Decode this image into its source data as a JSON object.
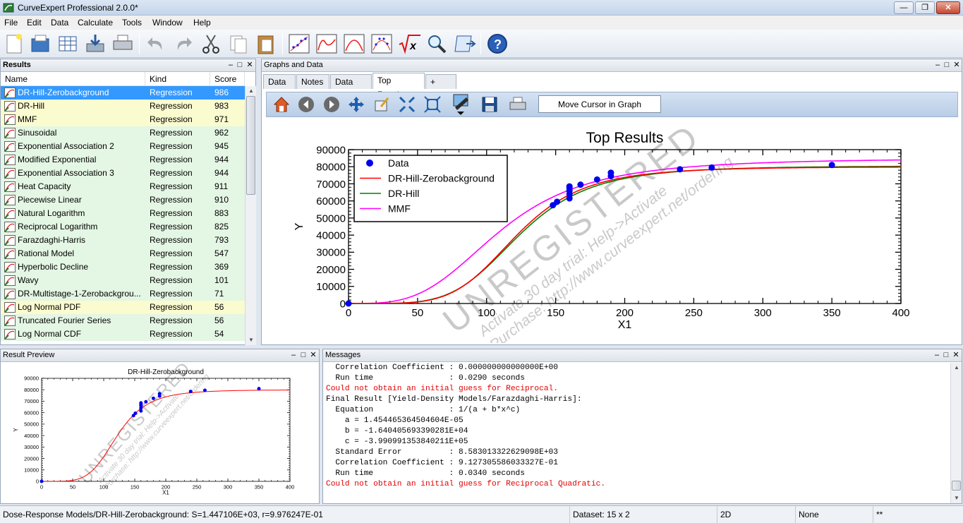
{
  "window": {
    "title": "CurveExpert Professional 2.0.0*",
    "minimize": "—",
    "maximize": "❐",
    "close": "✕"
  },
  "menu": [
    "File",
    "Edit",
    "Data",
    "Calculate",
    "Tools",
    "Window",
    "Help"
  ],
  "toolbar": {
    "buttons": [
      "new-icon",
      "open-icon",
      "data-grid-icon",
      "import-icon",
      "print-icon",
      "undo-icon",
      "redo-icon",
      "cut-icon",
      "copy-icon",
      "paste-icon",
      "scatter-plot-icon",
      "line-plot-icon",
      "curve-plot-icon",
      "residual-plot-icon",
      "function-icon",
      "zoom-icon",
      "script-icon",
      "help-icon"
    ]
  },
  "results_panel": {
    "title": "Results",
    "columns": [
      "Name",
      "Kind",
      "Score"
    ],
    "rows": [
      {
        "name": "DR-Hill-Zerobackground",
        "kind": "Regression",
        "score": "986",
        "color": "#3399ff",
        "selected": true
      },
      {
        "name": "DR-Hill",
        "kind": "Regression",
        "score": "983",
        "color": "#fbfbd0"
      },
      {
        "name": "MMF",
        "kind": "Regression",
        "score": "971",
        "color": "#fbfbd0"
      },
      {
        "name": "Sinusoidal",
        "kind": "Regression",
        "score": "962",
        "color": "#e4f6e4"
      },
      {
        "name": "Exponential Association 2",
        "kind": "Regression",
        "score": "945",
        "color": "#e4f6e4"
      },
      {
        "name": "Modified Exponential",
        "kind": "Regression",
        "score": "944",
        "color": "#e4f6e4"
      },
      {
        "name": "Exponential Association 3",
        "kind": "Regression",
        "score": "944",
        "color": "#e4f6e4"
      },
      {
        "name": "Heat Capacity",
        "kind": "Regression",
        "score": "911",
        "color": "#e4f6e4"
      },
      {
        "name": "Piecewise Linear",
        "kind": "Regression",
        "score": "910",
        "color": "#e4f6e4"
      },
      {
        "name": "Natural Logarithm",
        "kind": "Regression",
        "score": "883",
        "color": "#e4f6e4"
      },
      {
        "name": "Reciprocal Logarithm",
        "kind": "Regression",
        "score": "825",
        "color": "#e4f6e4"
      },
      {
        "name": "Farazdaghi-Harris",
        "kind": "Regression",
        "score": "793",
        "color": "#e4f6e4"
      },
      {
        "name": "Rational Model",
        "kind": "Regression",
        "score": "547",
        "color": "#e4f6e4"
      },
      {
        "name": "Hyperbolic Decline",
        "kind": "Regression",
        "score": "369",
        "color": "#e4f6e4"
      },
      {
        "name": "Wavy",
        "kind": "Regression",
        "score": "101",
        "color": "#e4f6e4"
      },
      {
        "name": "DR-Multistage-1-Zerobackgrou...",
        "kind": "Regression",
        "score": "71",
        "color": "#e4f6e4"
      },
      {
        "name": "Log Normal PDF",
        "kind": "Regression",
        "score": "56",
        "color": "#fbfbd0"
      },
      {
        "name": "Truncated Fourier Series",
        "kind": "Regression",
        "score": "56",
        "color": "#e4f6e4"
      },
      {
        "name": "Log Normal CDF",
        "kind": "Regression",
        "score": "54",
        "color": "#e4f6e4"
      }
    ]
  },
  "graphs_panel": {
    "title": "Graphs and Data",
    "tabs": [
      "Data",
      "Notes",
      "Data Plot",
      "Top Results",
      "+"
    ],
    "active_tab": "Top Results",
    "graph_toolbar": [
      "home-icon",
      "back-icon",
      "forward-icon",
      "pan-icon",
      "edit-icon",
      "zoom-fit-icon",
      "zoom-select-icon",
      "color-icon",
      "save-icon",
      "print-icon"
    ],
    "cursor_label": "Move Cursor in Graph"
  },
  "chart_data": [
    {
      "type": "scatter",
      "title": "Top Results",
      "xlabel": "X1",
      "ylabel": "Y",
      "xlim": [
        0,
        400
      ],
      "ylim": [
        0,
        90000
      ],
      "xticks": [
        "0",
        "50",
        "100",
        "150",
        "200",
        "250",
        "300",
        "350",
        "400"
      ],
      "yticks": [
        "0",
        "10000",
        "20000",
        "30000",
        "40000",
        "50000",
        "60000",
        "70000",
        "80000",
        "90000"
      ],
      "legend_position": "top-left",
      "grid": false,
      "points": [
        [
          0,
          0
        ],
        [
          148,
          57500
        ],
        [
          151,
          59500
        ],
        [
          160,
          61500
        ],
        [
          160,
          64000
        ],
        [
          160,
          66000
        ],
        [
          160,
          67500
        ],
        [
          160,
          68500
        ],
        [
          168,
          69500
        ],
        [
          180,
          72500
        ],
        [
          190,
          74500
        ],
        [
          190,
          76500
        ],
        [
          240,
          78500
        ],
        [
          263,
          79500
        ],
        [
          350,
          81000
        ]
      ],
      "series": [
        {
          "name": "Data",
          "color": "#0000ee",
          "style": "points"
        },
        {
          "name": "DR-Hill-Zerobackground",
          "color": "#ff0000",
          "style": "line",
          "params": {
            "top": 80000,
            "ec50": 122,
            "slope": 5.0
          }
        },
        {
          "name": "DR-Hill",
          "color": "#008000",
          "style": "line",
          "params": {
            "top": 80500,
            "ec50": 124,
            "slope": 4.8
          }
        },
        {
          "name": "MMF",
          "color": "#ff00ff",
          "style": "line",
          "params": {
            "top": 85000,
            "ec50": 110,
            "slope": 3.4
          }
        }
      ],
      "watermark": [
        "UNREGISTERED",
        "Activate 30 day trial: Help->Activate",
        "Purchase: http://www.curveexpert.net/ordering"
      ]
    },
    {
      "type": "scatter",
      "title": "DR-Hill-Zerobackground",
      "xlabel": "X1",
      "ylabel": "Y",
      "xlim": [
        0,
        400
      ],
      "ylim": [
        0,
        90000
      ],
      "xticks": [
        "0",
        "50",
        "100",
        "150",
        "200",
        "250",
        "300",
        "350",
        "400"
      ],
      "yticks": [
        "0",
        "10000",
        "20000",
        "30000",
        "40000",
        "50000",
        "60000",
        "70000",
        "80000",
        "90000"
      ],
      "grid": false,
      "points": [
        [
          0,
          0
        ],
        [
          148,
          57500
        ],
        [
          151,
          59500
        ],
        [
          160,
          61500
        ],
        [
          160,
          64000
        ],
        [
          160,
          66000
        ],
        [
          160,
          67500
        ],
        [
          160,
          68500
        ],
        [
          168,
          69500
        ],
        [
          180,
          72500
        ],
        [
          190,
          74500
        ],
        [
          190,
          76500
        ],
        [
          240,
          78500
        ],
        [
          263,
          79500
        ],
        [
          350,
          81000
        ]
      ],
      "series": [
        {
          "name": "DR-Hill-Zerobackground",
          "color": "#ff0000",
          "style": "line",
          "params": {
            "top": 80000,
            "ec50": 122,
            "slope": 5.0
          }
        }
      ],
      "watermark": [
        "UNREGISTERED",
        "Activate 30 day trial: Help->Activate",
        "Purchase: http://www.curveexpert.net/ordering"
      ]
    }
  ],
  "preview_panel": {
    "title": "Result Preview"
  },
  "messages_panel": {
    "title": "Messages",
    "lines": [
      {
        "text": "  Correlation Coefficient : 0.000000000000000E+00",
        "error": false
      },
      {
        "text": "  Run time                : 0.0290 seconds",
        "error": false
      },
      {
        "text": "Could not obtain an initial guess for Reciprocal.",
        "error": true
      },
      {
        "text": "Final Result [Yield-Density Models/Farazdaghi-Harris]:",
        "error": false
      },
      {
        "text": "  Equation                : 1/(a + b*x^c)",
        "error": false
      },
      {
        "text": "    a = 1.454465364504604E-05",
        "error": false
      },
      {
        "text": "    b = -1.640405693390281E+04",
        "error": false
      },
      {
        "text": "    c = -3.990991353840211E+05",
        "error": false
      },
      {
        "text": "  Standard Error          : 8.583013322629098E+03",
        "error": false
      },
      {
        "text": "  Correlation Coefficient : 9.127305586033327E-01",
        "error": false
      },
      {
        "text": "  Run time                : 0.0340 seconds",
        "error": false
      },
      {
        "text": "Could not obtain an initial guess for Reciprocal Quadratic.",
        "error": true
      }
    ]
  },
  "statusbar": {
    "model": "Dose-Response Models/DR-Hill-Zerobackground: S=1.447106E+03, r=9.976247E-01",
    "dataset": "Dataset: 15 x 2",
    "mode": "2D",
    "selection": "None",
    "flag": "**"
  },
  "panel_controls": {
    "minimize": "‒",
    "float": "□",
    "close": "✕"
  }
}
